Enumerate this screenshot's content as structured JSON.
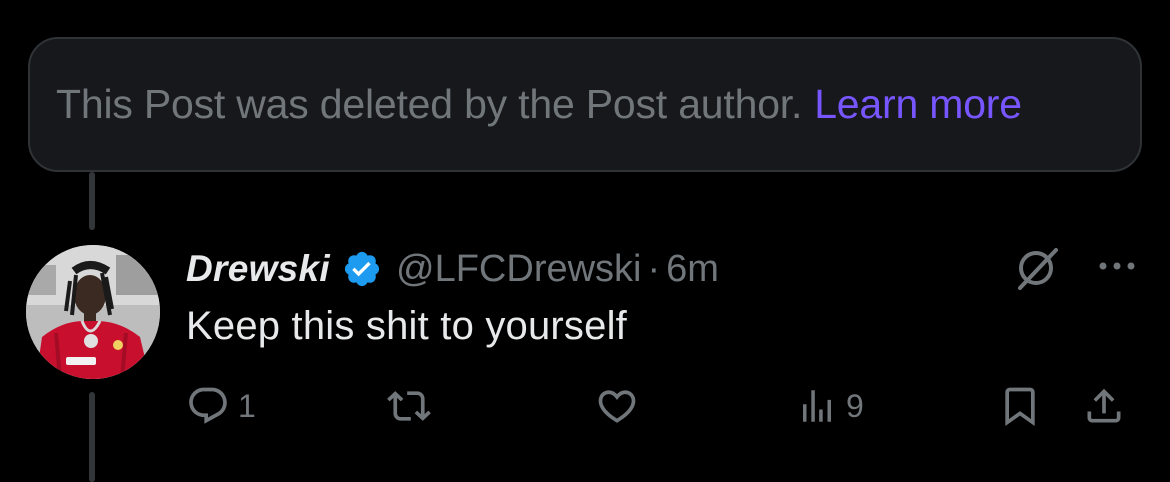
{
  "deleted_notice": {
    "text": "This Post was deleted by the Post author.",
    "link_label": "Learn more"
  },
  "post": {
    "display_name": "Drewski",
    "handle": "@LFCDrewski",
    "separator": "·",
    "time": "6m",
    "text": "Keep this shit to yourself",
    "verified": true,
    "avatar_icon": "profile-photo"
  },
  "actions": {
    "reply_count": "1",
    "repost_count": "",
    "like_count": "",
    "views_count": "9"
  },
  "icons": {
    "reply": "comment-bubble-icon",
    "repost": "repost-arrows-icon",
    "like": "heart-icon",
    "views": "bar-chart-icon",
    "bookmark": "bookmark-icon",
    "share": "share-upload-icon",
    "grok": "grok-slash-circle-icon",
    "more": "ellipsis-icon"
  },
  "colors": {
    "background": "#000000",
    "card_background": "#16181c",
    "muted_text": "#71767b",
    "primary_text": "#e7e9ea",
    "link": "#7856ff",
    "verified_badge": "#1d9bf0"
  }
}
